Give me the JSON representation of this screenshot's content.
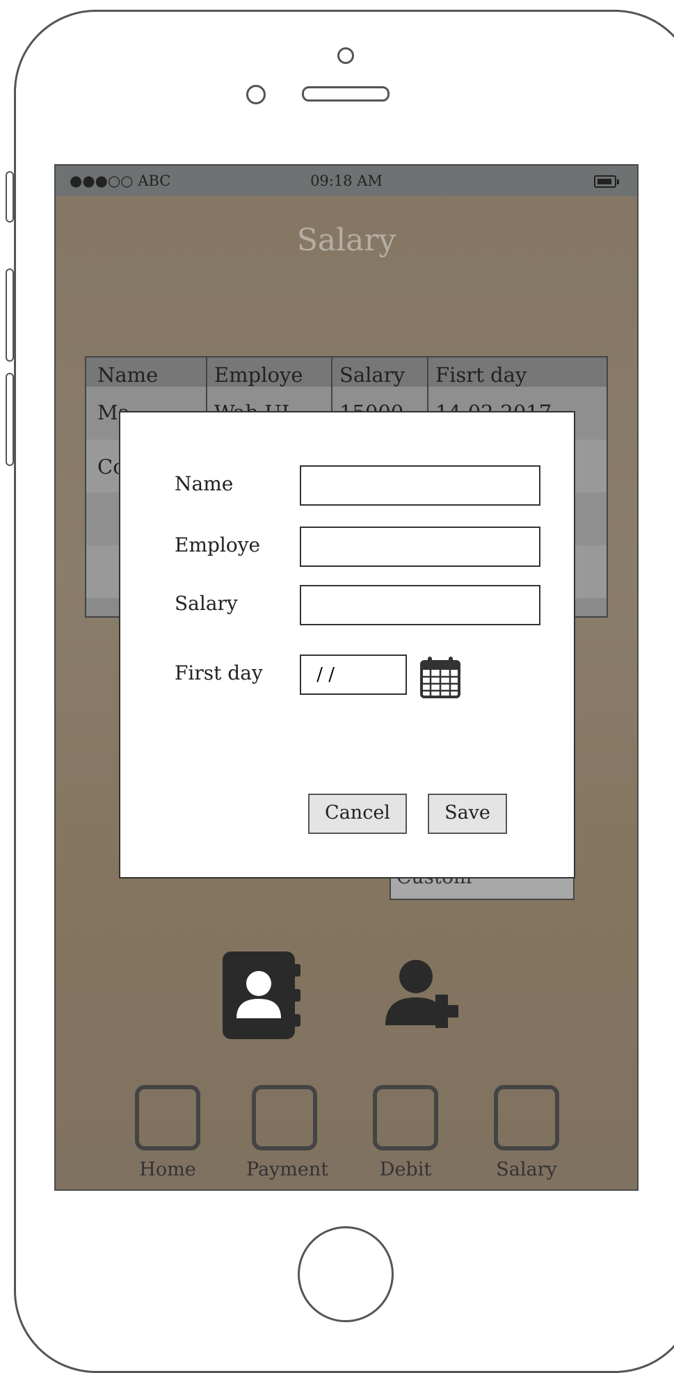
{
  "status_bar": {
    "carrier": "●●●○○ ABC",
    "time": "09:18 AM"
  },
  "screen_title": "Salary",
  "table": {
    "headers": [
      "Name",
      "Employe",
      "Salary",
      "Fisrt day"
    ],
    "rows": [
      [
        "Ma",
        "Wab UI",
        "15000",
        "14-02-2017"
      ],
      [
        "Co",
        "",
        "",
        ""
      ]
    ]
  },
  "custom_label": "Custom",
  "dialog": {
    "name_label": "Name",
    "employe_label": "Employe",
    "salary_label": "Salary",
    "first_day_label": "First day",
    "date_value": " / /",
    "cancel_label": "Cancel",
    "save_label": "Save"
  },
  "nav": {
    "items": [
      {
        "label": "Home"
      },
      {
        "label": "Payment"
      },
      {
        "label": "Debit"
      },
      {
        "label": "Salary"
      }
    ]
  },
  "colors": {
    "screen_bg": "#857664",
    "status_bar": "#6f7273",
    "title": "#b6aea2"
  }
}
